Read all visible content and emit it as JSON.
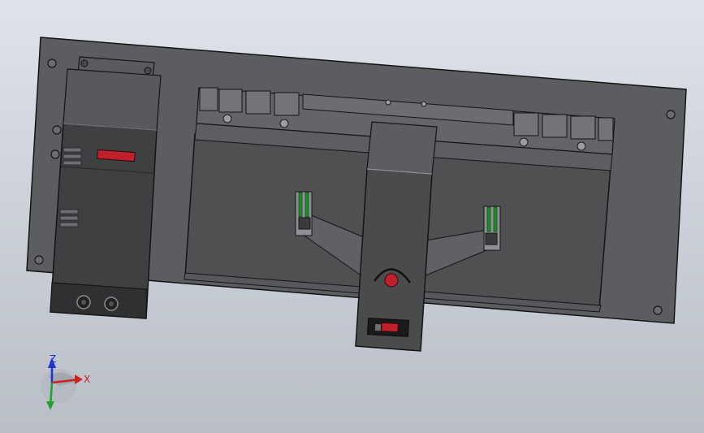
{
  "viewport": {
    "background_top": "#dfe3ea",
    "background_bottom": "#b9bec7"
  },
  "model": {
    "base_plate_color": "#5b5d61",
    "edge_color": "#141414",
    "module_color": "#404142",
    "panel_color": "#3a3b3d",
    "accent_red": "#c0202a",
    "accent_green": "#1f8b2a"
  },
  "triad": {
    "x_label": "X",
    "z_label": "Z",
    "x_color": "#cc2222",
    "y_color": "#22a033",
    "z_color": "#2233cc"
  }
}
